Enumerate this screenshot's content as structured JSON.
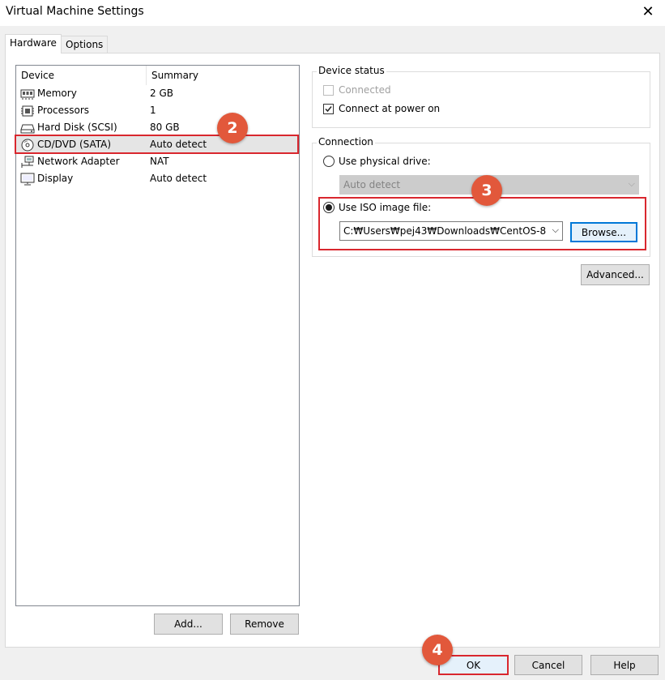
{
  "window": {
    "title": "Virtual Machine Settings",
    "close_glyph": "✕"
  },
  "tabs": [
    {
      "label": "Hardware"
    },
    {
      "label": "Options"
    }
  ],
  "device_list": {
    "columns": [
      "Device",
      "Summary"
    ],
    "rows": [
      {
        "name": "Memory",
        "summary": "2 GB",
        "icon": "memory-icon"
      },
      {
        "name": "Processors",
        "summary": "1",
        "icon": "processor-icon"
      },
      {
        "name": "Hard Disk (SCSI)",
        "summary": "80 GB",
        "icon": "hard-disk-icon"
      },
      {
        "name": "CD/DVD (SATA)",
        "summary": "Auto detect",
        "icon": "cd-dvd-icon",
        "selected": true
      },
      {
        "name": "Network Adapter",
        "summary": "NAT",
        "icon": "network-adapter-icon"
      },
      {
        "name": "Display",
        "summary": "Auto detect",
        "icon": "display-icon"
      }
    ]
  },
  "left_buttons": {
    "add": "Add...",
    "remove": "Remove"
  },
  "device_status": {
    "title": "Device status",
    "connected": "Connected",
    "connect_power_on": "Connect at power on"
  },
  "connection": {
    "title": "Connection",
    "physical_label": "Use physical drive:",
    "physical_value": "Auto detect",
    "iso_label": "Use ISO image file:",
    "iso_value": "C:₩Users₩pej43₩Downloads₩CentOS-8",
    "browse": "Browse..."
  },
  "advanced": "Advanced...",
  "footer": {
    "ok": "OK",
    "cancel": "Cancel",
    "help": "Help"
  },
  "annotations": {
    "step2": "2",
    "step3": "3",
    "step4": "4"
  },
  "colors": {
    "highlight": "#d9272e",
    "badge": "#e2583b",
    "focus": "#0078d7"
  }
}
